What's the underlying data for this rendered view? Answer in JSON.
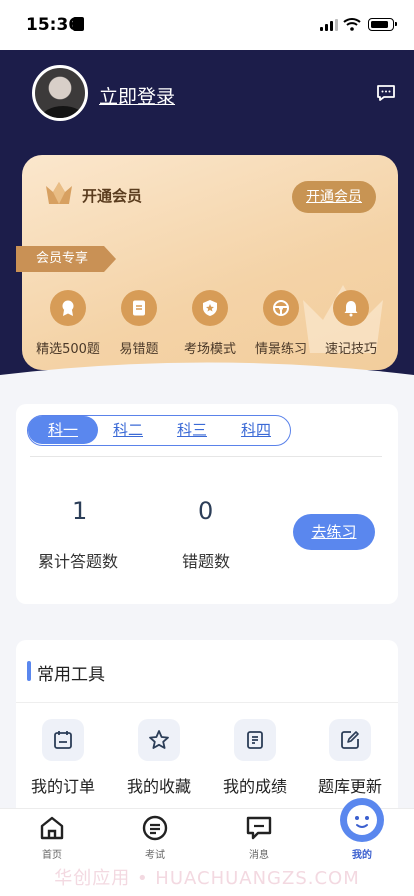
{
  "status_bar": {
    "time": "15:36"
  },
  "header": {
    "login_text": "立即登录"
  },
  "vip": {
    "title": "开通会员",
    "open_button": "开通会员",
    "tag": "会员专享",
    "features": [
      {
        "label": "精选500题",
        "icon": "medal-icon"
      },
      {
        "label": "易错题",
        "icon": "document-icon"
      },
      {
        "label": "考场模式",
        "icon": "shield-star-icon"
      },
      {
        "label": "情景练习",
        "icon": "steering-wheel-icon"
      },
      {
        "label": "速记技巧",
        "icon": "bell-icon"
      }
    ]
  },
  "practice": {
    "tabs": [
      "科一",
      "科二",
      "科三",
      "科四"
    ],
    "active_tab": "科一",
    "stats": [
      {
        "value": "1",
        "label": "累计答题数"
      },
      {
        "value": "0",
        "label": "错题数"
      }
    ],
    "button": "去练习"
  },
  "tools": {
    "title": "常用工具",
    "items": [
      {
        "label": "我的订单",
        "icon": "calendar-icon"
      },
      {
        "label": "我的收藏",
        "icon": "star-icon"
      },
      {
        "label": "我的成绩",
        "icon": "report-icon"
      },
      {
        "label": "题库更新",
        "icon": "edit-icon"
      }
    ]
  },
  "nav": {
    "items": [
      {
        "label": "首页",
        "icon": "home-icon"
      },
      {
        "label": "考试",
        "icon": "exam-icon"
      },
      {
        "label": "消息",
        "icon": "message-icon"
      },
      {
        "label": "我的",
        "icon": "profile-icon"
      }
    ],
    "active": "我的"
  },
  "watermark": "华创应用 • HUACHUANGZS.COM",
  "colors": {
    "header_dark": "#1c1d4a",
    "accent_blue": "#5a87ee",
    "vip_gold": "#c99155"
  }
}
